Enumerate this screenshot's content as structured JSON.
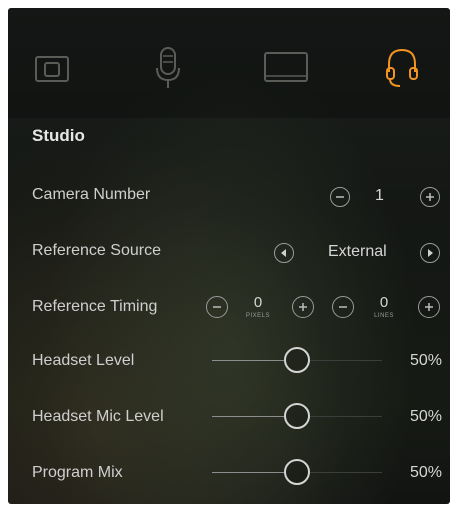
{
  "tabs": [
    {
      "name": "camera-tab",
      "icon": "camera-icon"
    },
    {
      "name": "microphone-tab",
      "icon": "microphone-icon"
    },
    {
      "name": "monitor-tab",
      "icon": "monitor-icon"
    },
    {
      "name": "headset-tab",
      "icon": "headset-icon",
      "active": true
    }
  ],
  "colors": {
    "accent": "#f29322",
    "inactive_icon": "#5a5c58"
  },
  "section": {
    "title": "Studio"
  },
  "camera_number": {
    "label": "Camera Number",
    "value": "1"
  },
  "reference_source": {
    "label": "Reference Source",
    "value": "External"
  },
  "reference_timing": {
    "label": "Reference Timing",
    "pixels_value": "0",
    "pixels_caption": "PIXELS",
    "lines_value": "0",
    "lines_caption": "LINES"
  },
  "headset_level": {
    "label": "Headset Level",
    "percent": "50%",
    "level": 0.5
  },
  "headset_mic_level": {
    "label": "Headset Mic Level",
    "percent": "50%",
    "level": 0.5
  },
  "program_mix": {
    "label": "Program Mix",
    "percent": "50%",
    "level": 0.5
  }
}
